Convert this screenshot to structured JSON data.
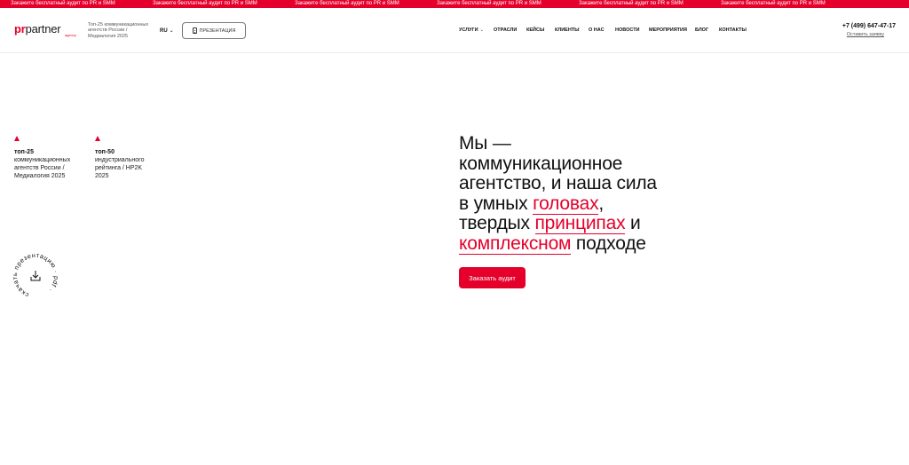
{
  "ticker": {
    "items": [
      "Закажите бесплатный аудит по PR и SMM",
      "Закажите бесплатный аудит по PR и SMM",
      "Закажите бесплатный аудит по PR и SMM",
      "Закажите бесплатный аудит по PR и SMM",
      "Закажите бесплатный аудит по PR и SMM",
      "Закажите бесплатный аудит по PR и SMM"
    ]
  },
  "header": {
    "logo": {
      "pr": "pr",
      "partner": "partner",
      "sub": "agency"
    },
    "tagline": "Топ-25 коммуникационных агентств России / Медиалогия 2025",
    "lang": "RU",
    "presentation_button": "ПРЕЗЕНТАЦИЯ",
    "nav": [
      {
        "label": "УСЛУГИ",
        "dropdown": true
      },
      {
        "label": "ОТРАСЛИ"
      },
      {
        "label": "КЕЙСЫ"
      },
      {
        "label": "КЛИЕНТЫ"
      },
      {
        "label": "О НАС"
      },
      {
        "label": "НОВОСТИ"
      },
      {
        "label": "МЕРОПРИЯТИЯ"
      },
      {
        "label": "БЛОГ"
      },
      {
        "label": "КОНТАКТЫ"
      }
    ],
    "phone": "+7 (499) 647-47-17",
    "callback": "Оставить заявку"
  },
  "badges": [
    {
      "title": "топ-25",
      "desc": [
        "коммуникационных",
        "агентств России /",
        "Медиалогия 2025"
      ]
    },
    {
      "title": "топ-50",
      "desc": [
        "индустриального",
        "рейтинга / HP2K",
        "2025"
      ]
    }
  ],
  "download": {
    "ring_text": "скачать презентацию · pdf ·"
  },
  "hero": {
    "line1": "Мы —",
    "line2": "коммуникационное",
    "line3": "агентство, и наша сила",
    "line4a": "в умных ",
    "line4hl": "головах",
    "line4b": ",",
    "line5a": "твердых ",
    "line5hl": "принципах",
    "line5b": " и",
    "line6hl": "комплексном",
    "line6b": " подходе",
    "cta": "Заказать аудит"
  },
  "colors": {
    "accent": "#e4002b"
  }
}
